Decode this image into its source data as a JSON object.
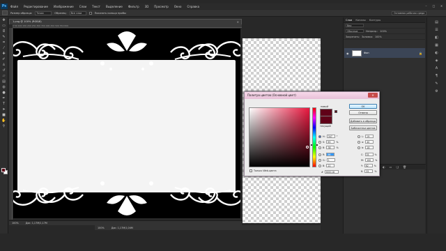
{
  "app": {
    "logo": "Ps"
  },
  "menu": {
    "items": [
      "Файл",
      "Редактирование",
      "Изображение",
      "Слои",
      "Текст",
      "Выделение",
      "Фильтр",
      "3D",
      "Просмотр",
      "Окно",
      "Справка"
    ]
  },
  "window_buttons": {
    "minimize": "–",
    "maximize": "□",
    "close": "✕"
  },
  "options_bar": {
    "sample_size_label": "Размер образца:",
    "sample_size_value": "Точка",
    "sample_label": "Образец:",
    "sample_value": "Все слои",
    "show_ring_label": "Показать кольцо пробы",
    "workspace": "Основная рабочая среда"
  },
  "tools": [
    "move",
    "marquee",
    "lasso",
    "quick-select",
    "crop",
    "eyedropper",
    "heal",
    "brush",
    "stamp",
    "history-brush",
    "eraser",
    "gradient",
    "blur",
    "dodge",
    "pen",
    "type",
    "path-select",
    "shape",
    "hand",
    "zoom"
  ],
  "document": {
    "tab_title": "1.png @ 100% (RGB/8)",
    "tab_close": "×",
    "ruler_marks": "0    50   100   150   200   250   300   350   400   450   500   550   600",
    "zoom": "100%",
    "doc_size": "Док: 1,17М/1,17М"
  },
  "document2": {
    "zoom": "100%",
    "doc_size": "Док: 1,17М/1,04М"
  },
  "panel": {
    "tabs": [
      "Слои",
      "Каналы",
      "Контуры"
    ],
    "kind_label": "Вид",
    "blend_mode": "Обычные",
    "opacity_label": "Непрозр.:",
    "opacity_value": "100%",
    "lock_label": "Закрепить:",
    "fill_label": "Заливка:",
    "fill_value": "100%",
    "layer_name": "Фон",
    "footer_icons": [
      "link",
      "fx",
      "mask",
      "adjust",
      "folder",
      "new",
      "trash"
    ]
  },
  "color_picker": {
    "title": "Палитра цветов (Основной цвет)",
    "close": "✕",
    "label_new": "новый",
    "label_current": "текущий",
    "buttons": {
      "ok": "OK",
      "cancel": "Отмена",
      "add_swatch": "Добавить в образцы",
      "libraries": "Библиотеки цветов"
    },
    "fields": {
      "H": {
        "label": "H:",
        "value": "347",
        "unit": "°"
      },
      "S": {
        "label": "S:",
        "value": "99",
        "unit": "%"
      },
      "B": {
        "label": "B:",
        "value": "38",
        "unit": "%"
      },
      "R": {
        "label": "R:",
        "value": "96",
        "unit": ""
      },
      "G": {
        "label": "G:",
        "value": "1",
        "unit": ""
      },
      "Bl": {
        "label": "B:",
        "value": "22",
        "unit": ""
      },
      "L": {
        "label": "L:",
        "value": "19",
        "unit": ""
      },
      "a": {
        "label": "a:",
        "value": "40",
        "unit": ""
      },
      "b": {
        "label": "b:",
        "value": "18",
        "unit": ""
      },
      "C": {
        "label": "C:",
        "value": "35",
        "unit": "%"
      },
      "M": {
        "label": "M:",
        "value": "100",
        "unit": "%"
      },
      "Y": {
        "label": "Y:",
        "value": "62",
        "unit": "%"
      },
      "K": {
        "label": "K:",
        "value": "55",
        "unit": "%"
      },
      "hex": {
        "label": "#",
        "value": "600118"
      }
    },
    "web_only_label": "Только Web-цвета",
    "colors": {
      "selected": "#600118",
      "hue": "#e8173e"
    }
  }
}
